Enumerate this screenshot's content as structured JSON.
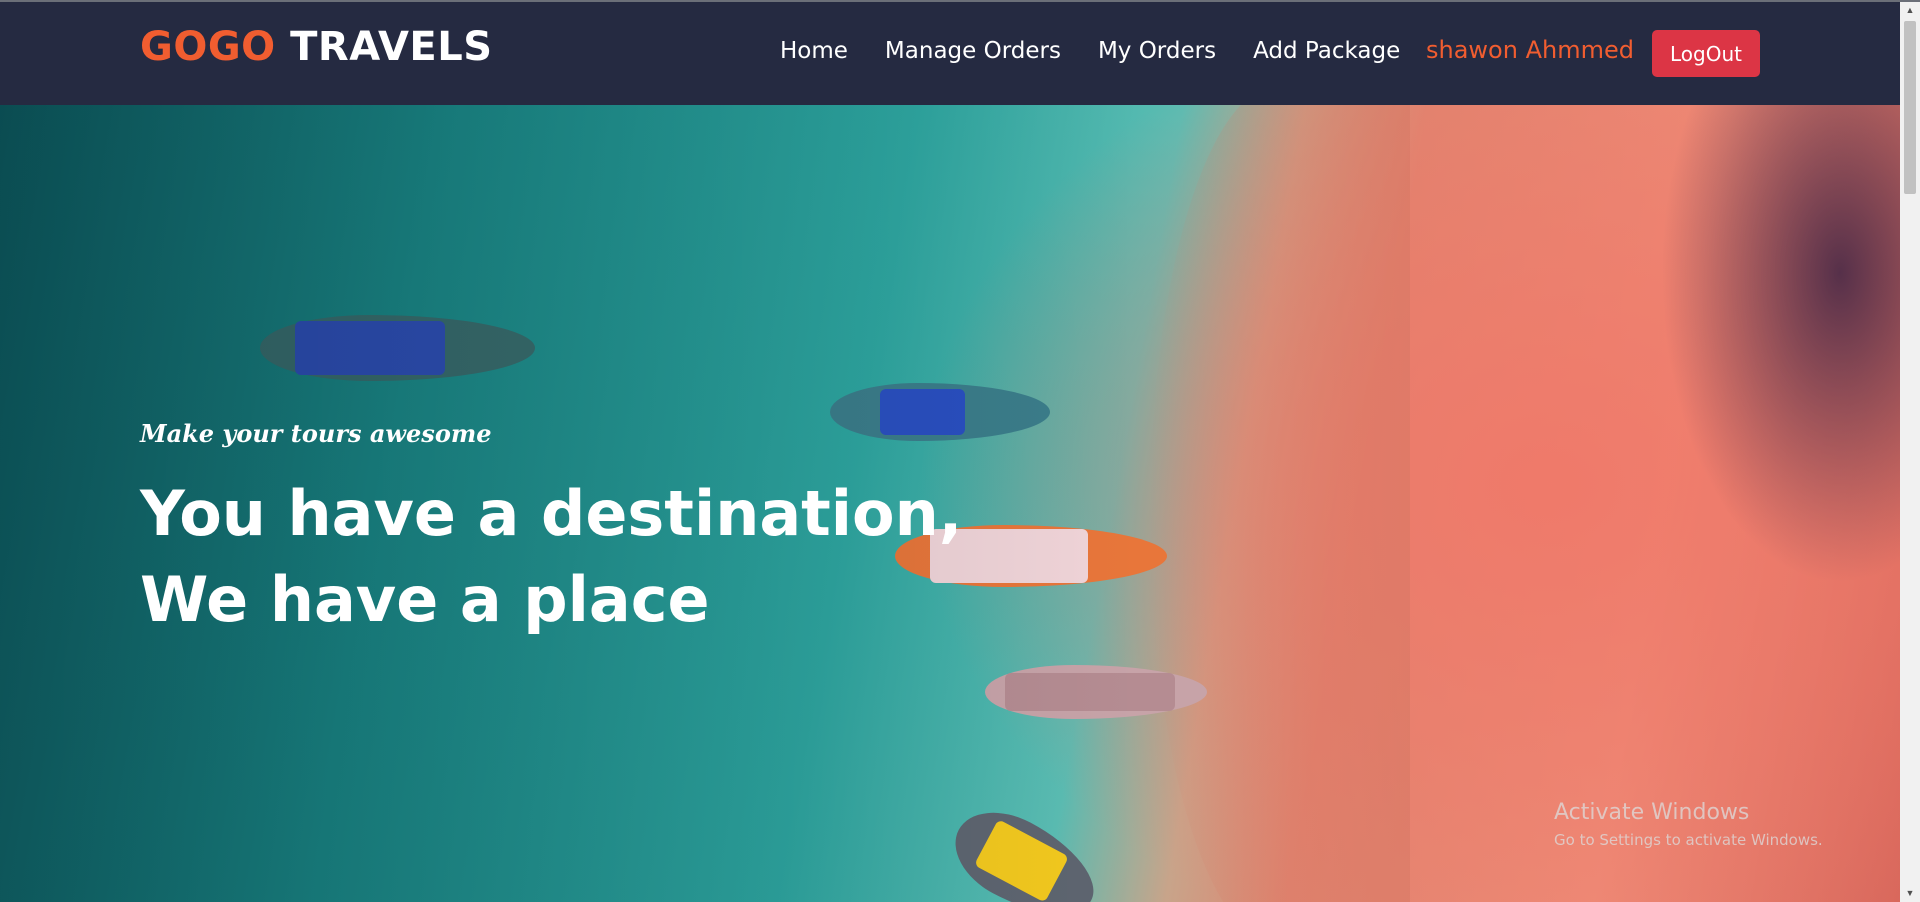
{
  "brand": {
    "part1": "GOGO",
    "part2": "TRAVELS",
    "accent_color": "#f15d30"
  },
  "nav": {
    "links": [
      {
        "label": "Home"
      },
      {
        "label": "Manage Orders"
      },
      {
        "label": "My Orders"
      },
      {
        "label": "Add Package"
      }
    ],
    "user_name": "shawon Ahmmed",
    "logout_label": "LogOut",
    "background": "#252a41"
  },
  "hero": {
    "tagline": "Make your tours awesome",
    "headline_line1": "You have a destination,",
    "headline_line2": "We have a place"
  },
  "watermark": {
    "line1": "Activate Windows",
    "line2": "Go to Settings to activate Windows."
  },
  "scrollbar": {
    "up_icon": "arrow-up",
    "down_icon": "arrow-down"
  }
}
